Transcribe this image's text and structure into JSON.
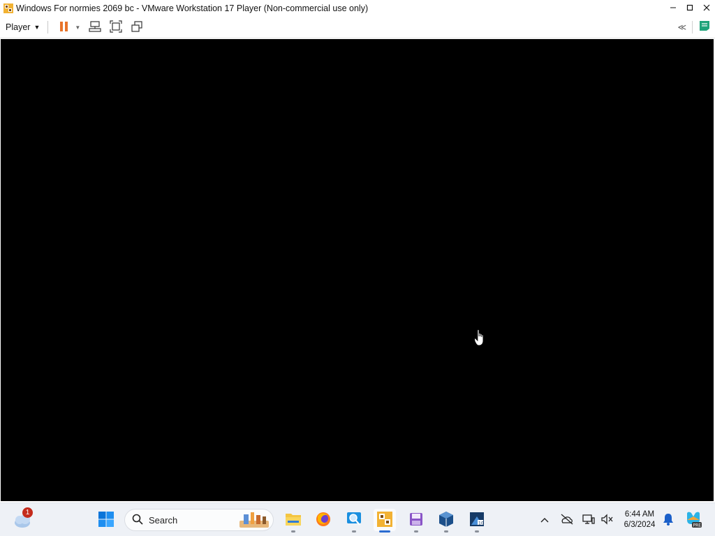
{
  "window": {
    "title": "Windows For normies 2069 bc - VMware Workstation 17 Player (Non-commercial use only)",
    "minimize_icon": "minimize-icon",
    "maximize_icon": "maximize-icon",
    "close_icon": "close-icon"
  },
  "toolbar": {
    "player_menu_label": "Player",
    "icons": [
      "pause-icon",
      "send-ctrl-alt-del-icon",
      "full-screen-icon",
      "unity-icon",
      "collapse-icon",
      "message-log-icon"
    ]
  },
  "vm": {
    "screen_color": "#000000"
  },
  "taskbar": {
    "weather_badge": "1",
    "search_label": "Search",
    "pinned": [
      "start-icon",
      "file-explorer-icon",
      "firefox-icon",
      "magnifier-app-icon",
      "vmware-player-icon",
      "floppy-app-icon",
      "virtualbox-icon",
      "windows-10-app-icon"
    ],
    "active_app": "vmware-player-icon"
  },
  "tray": {
    "time": "6:44 AM",
    "date": "6/3/2024",
    "icons": [
      "chevron-up-icon",
      "onedrive-offline-icon",
      "network-icon",
      "volume-muted-icon",
      "notification-bell-icon",
      "copilot-icon"
    ]
  },
  "colors": {
    "accent": "#2b6cd1",
    "pause_orange": "#e8742a",
    "badge_red": "#c42b1c"
  }
}
